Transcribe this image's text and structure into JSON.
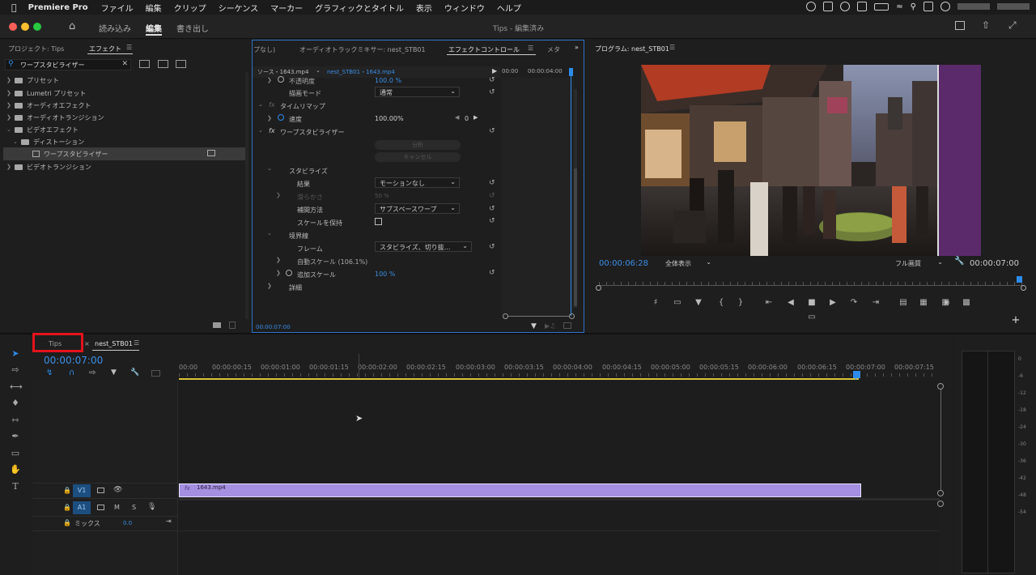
{
  "menubar": {
    "app": "Premiere Pro",
    "items": [
      "ファイル",
      "編集",
      "クリップ",
      "シーケンス",
      "マーカー",
      "グラフィックとタイトル",
      "表示",
      "ウィンドウ",
      "ヘルプ"
    ]
  },
  "titlebar": {
    "workspaces": [
      "読み込み",
      "編集",
      "書き出し"
    ],
    "active_workspace": "編集",
    "title": "Tips - 編集済み"
  },
  "effects_panel": {
    "tabs": [
      "プロジェクト: Tips",
      "エフェクト"
    ],
    "search_value": "ワープスタビライザー",
    "tree": [
      {
        "label": "プリセット",
        "level": 0
      },
      {
        "label": "Lumetri プリセット",
        "level": 0
      },
      {
        "label": "オーディオエフェクト",
        "level": 0
      },
      {
        "label": "オーディオトランジション",
        "level": 0
      },
      {
        "label": "ビデオエフェクト",
        "level": 0,
        "open": true
      },
      {
        "label": "ディストーション",
        "level": 1,
        "open": true
      },
      {
        "label": "ワープスタビライザー",
        "level": 2,
        "selected": true
      },
      {
        "label": "ビデオトランジション",
        "level": 0
      }
    ]
  },
  "effect_controls": {
    "tabs": [
      "プなし)",
      "オーディオトラックミキサー: nest_STB01",
      "エフェクトコントロール",
      "メタ"
    ],
    "source_label": "ソース・1643.mp4",
    "clip_label": "nest_STB01・1643.mp4",
    "ruler": [
      "00:00",
      "00:00:04:00"
    ],
    "rows": {
      "opacity_label": "不透明度",
      "opacity_value": "100.0 %",
      "blend_label": "描画モード",
      "blend_value": "通常",
      "timeremap_label": "タイムリマップ",
      "speed_label": "速度",
      "speed_value": "100.00%",
      "speed_keys": "0",
      "warp_label": "ワープスタビライザー",
      "analyze_btn": "分析",
      "cancel_btn": "キャンセル",
      "stabilize_label": "スタビライズ",
      "result_label": "結果",
      "result_value": "モーションなし",
      "smooth_label": "滑らかさ",
      "smooth_value": "50 %",
      "method_label": "補間方法",
      "method_value": "サブスペースワープ",
      "keepscale_label": "スケールを保持",
      "border_label": "境界線",
      "frame_label": "フレーム",
      "frame_value": "スタビライズ、切り抜...",
      "autoscale_label": "自動スケール (106.1%)",
      "addscale_label": "追加スケール",
      "addscale_value": "100 %",
      "detail_label": "詳細"
    },
    "footer_time": "00:00:07:00"
  },
  "program_monitor": {
    "title": "プログラム: nest_STB01",
    "current_time": "00:00:06:28",
    "zoom": "全体表示",
    "quality": "フル画質",
    "duration": "00:00:07:00"
  },
  "timeline": {
    "tabs": [
      "Tips",
      "nest_STB01"
    ],
    "timecode": "00:00:07:00",
    "ruler": [
      "00:00",
      "00:00:00:15",
      "00:00:01:00",
      "00:00:01:15",
      "00:00:02:00",
      "00:00:02:15",
      "00:00:03:00",
      "00:00:03:15",
      "00:00:04:00",
      "00:00:04:15",
      "00:00:05:00",
      "00:00:05:15",
      "00:00:06:00",
      "00:00:06:15",
      "00:00:07:00",
      "00:00:07:15"
    ],
    "v1_label": "V1",
    "a1_label": "A1",
    "mute": "M",
    "solo": "S",
    "mix_label": "ミックス",
    "mix_value": "0.0",
    "clip_name": "1643.mp4",
    "fx_badge": "fx"
  },
  "meter_scale": [
    "0",
    "-6",
    "-12",
    "-18",
    "-24",
    "-30",
    "-36",
    "-42",
    "-48",
    "-54"
  ],
  "colors": {
    "accent_blue": "#2d8ceb",
    "clip_purple": "#a48fe0",
    "highlight_red": "#e3131b"
  }
}
